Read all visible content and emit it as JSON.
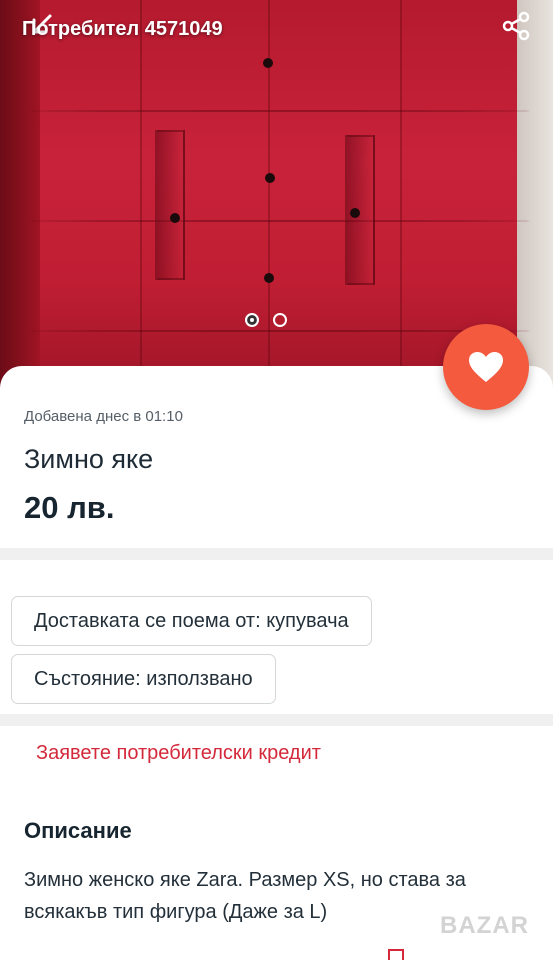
{
  "header": {
    "user_title": "Потребител 4571049"
  },
  "gallery": {
    "image_count": 2,
    "active_index": 0
  },
  "listing": {
    "added": "Добавена днес в 01:10",
    "title": "Зимно яке",
    "price": "20 лв."
  },
  "chips": {
    "delivery": "Доставката се поема от: купувача",
    "condition": "Състояние: използвано"
  },
  "credit_link": "Заявете потребителски кредит",
  "description": {
    "heading": "Описание",
    "text": "Зимно женско яке Zara. Размер XS, но става за всякакъв тип фигура (Даже за L)"
  },
  "watermark": "BAZAR",
  "colors": {
    "accent": "#f35a3e",
    "credit": "#d4293a",
    "jacket": "#c8223a"
  }
}
